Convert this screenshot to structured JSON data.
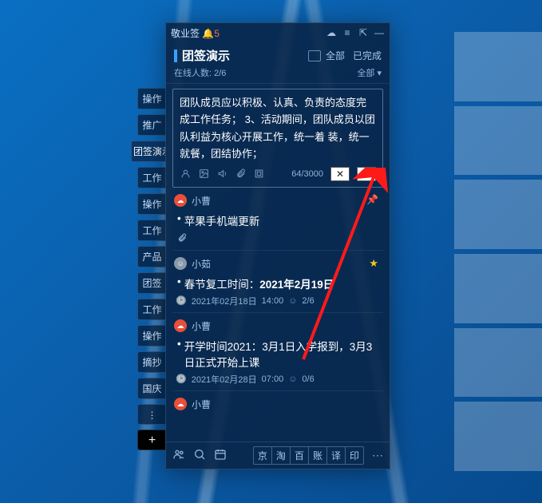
{
  "titlebar": {
    "app_name": "敬业签",
    "notif_count": "5"
  },
  "header": {
    "title": "团签演示",
    "filter_all": "全部",
    "filter_done": "已完成",
    "online_label": "在线人数:",
    "online_value": "2/6",
    "dropdown": "全部 ▾"
  },
  "editor": {
    "text": "团队成员应以积极、认真、负责的态度完成工作任务； 3、活动期间，团队成员以团队利益为核心开展工作，统一着 装，统一就餐，团结协作；",
    "count": "64/3000"
  },
  "notes": [
    {
      "author": "小曹",
      "avatar": "red",
      "body": "苹果手机端更新",
      "pinned": true,
      "has_attach": true
    },
    {
      "author": "小茹",
      "avatar": "gray",
      "body_prefix": "春节复工时间：",
      "body_bold": "2021年2月19日",
      "starred": true,
      "meta_date": "2021年02月18日",
      "meta_time": "14:00",
      "meta_people": "2/6"
    },
    {
      "author": "小曹",
      "avatar": "red",
      "body": "开学时间2021：3月1日入学报到，3月3日正式开始上课",
      "meta_date": "2021年02月28日",
      "meta_time": "07:00",
      "meta_people": "0/6"
    },
    {
      "author": "小曹",
      "avatar": "red"
    }
  ],
  "bottombar": {
    "links": [
      "京",
      "淘",
      "百",
      "账",
      "译",
      "印"
    ]
  },
  "side_tabs": [
    "操作",
    "推广",
    "团签演示",
    "工作",
    "操作",
    "工作",
    "产品",
    "团签",
    "工作",
    "操作",
    "摘抄",
    "国庆"
  ]
}
